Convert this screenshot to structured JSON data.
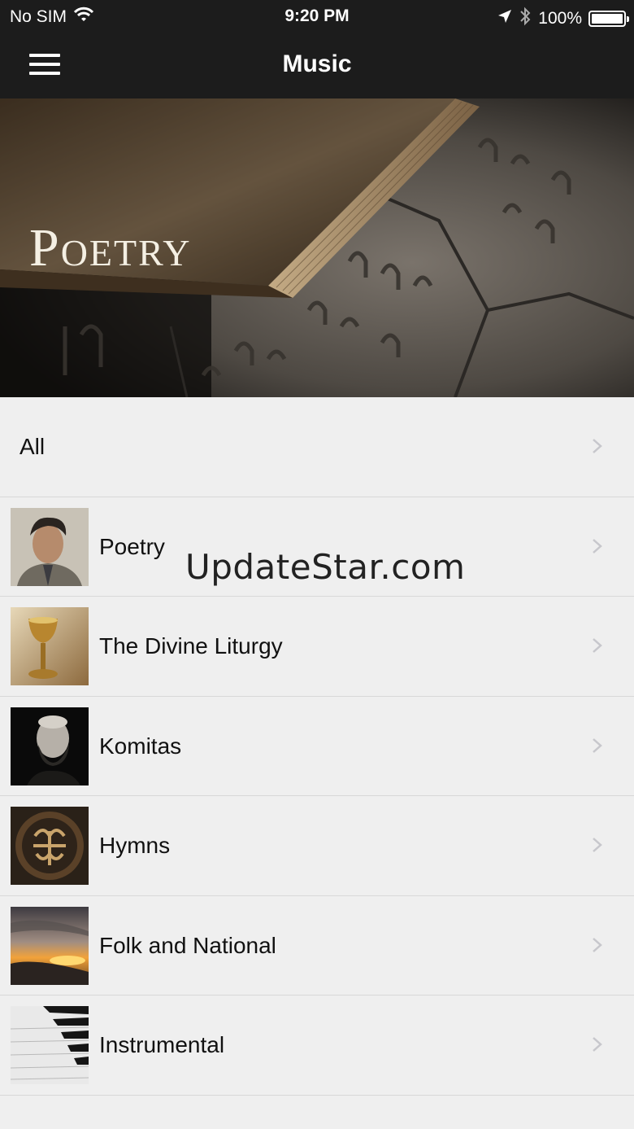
{
  "status_bar": {
    "carrier": "No SIM",
    "time": "9:20 PM",
    "battery": "100%",
    "icons": [
      "wifi-icon",
      "location-arrow-icon",
      "bluetooth-icon",
      "battery-icon"
    ]
  },
  "nav": {
    "title": "Music",
    "menu_icon": "hamburger-icon"
  },
  "hero": {
    "title": "Poetry"
  },
  "list": {
    "items": [
      {
        "label": "All"
      },
      {
        "label": "Poetry",
        "thumb": "portrait-man"
      },
      {
        "label": "The Divine Liturgy",
        "thumb": "chalice"
      },
      {
        "label": "Komitas",
        "thumb": "portrait-bearded-man"
      },
      {
        "label": "Hymns",
        "thumb": "ornament-seal"
      },
      {
        "label": "Folk and National",
        "thumb": "sunset"
      },
      {
        "label": "Instrumental",
        "thumb": "piano-keys"
      }
    ]
  },
  "watermark": "UpdateStar.com",
  "colors": {
    "bar_bg": "#1c1c1c",
    "list_bg": "#efefef",
    "separator": "#d8d8d8",
    "chevron": "#c7c7cc"
  }
}
